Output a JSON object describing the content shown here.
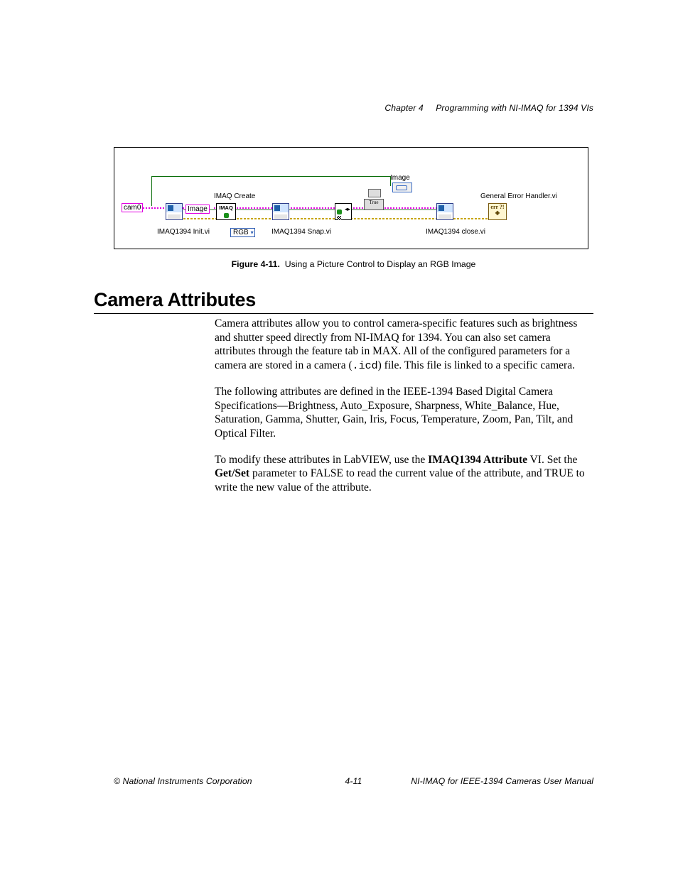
{
  "header": {
    "chapter_ref": "Chapter 4",
    "chapter_title": "Programming with NI-IMAQ for 1394 VIs"
  },
  "figure": {
    "number": "Figure 4-11.",
    "caption": "Using a Picture Control to Display an RGB Image",
    "diagram": {
      "control_cam0": "cam0",
      "control_image": "Image",
      "imaq_create_label": "IMAQ Create",
      "imaq_create_icon_text": "IMAQ",
      "imaq_init_label": "IMAQ1394 Init.vi",
      "imaq_snap_label": "IMAQ1394 Snap.vi",
      "imaq_close_label": "IMAQ1394 close.vi",
      "image_indicator_label": "Image",
      "error_handler_label": "General Error Handler.vi",
      "error_handler_icon_text": "err ?!◈",
      "bool_indicator_text": "True",
      "rgb_selector": "RGB"
    }
  },
  "section": {
    "heading": "Camera Attributes",
    "p1_part1": "Camera attributes allow you to control camera-specific features such as brightness and shutter speed directly from NI-IMAQ for 1394. You can also set camera attributes through the feature tab in MAX. All of the configured parameters for a camera are stored in a camera (",
    "p1_code": ".icd",
    "p1_part2": ") file. This file is linked to a specific camera.",
    "p2": "The following attributes are defined in the IEEE-1394 Based Digital Camera Specifications—Brightness, Auto_Exposure, Sharpness, White_Balance, Hue, Saturation, Gamma, Shutter, Gain, Iris, Focus, Temperature, Zoom, Pan, Tilt, and Optical Filter.",
    "p3_part1": "To modify these attributes in LabVIEW, use the ",
    "p3_bold1": "IMAQ1394 Attribute",
    "p3_part2": " VI. Set the ",
    "p3_bold2": "Get/Set",
    "p3_part3": " parameter to FALSE to read the current value of the attribute, and TRUE to write the new value of the attribute."
  },
  "footer": {
    "left": "© National Instruments Corporation",
    "center": "4-11",
    "right": "NI-IMAQ for IEEE-1394 Cameras User Manual"
  }
}
